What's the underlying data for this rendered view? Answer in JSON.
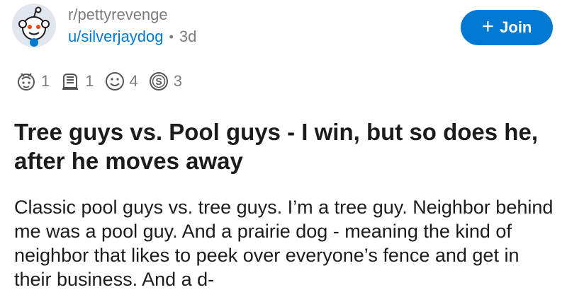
{
  "post": {
    "subreddit": "r/pettyrevenge",
    "author": "u/silverjaydog",
    "separator": "•",
    "age": "3d",
    "join_label": "Join",
    "join_icon": "plus-icon",
    "awards": [
      {
        "icon": "award-ribbon-icon",
        "count": "1"
      },
      {
        "icon": "award-hands-icon",
        "count": "1"
      },
      {
        "icon": "award-face-icon",
        "count": "4"
      },
      {
        "icon": "award-coin-icon",
        "count": "3"
      }
    ],
    "title": "Tree guys vs. Pool guys - I win, but so does he, after he moves away",
    "body": "Classic pool guys vs. tree guys. I’m a tree guy. Neighbor behind me was a pool guy. And a prairie dog - meaning the kind of neighbor that likes to peek over everyone’s fence and get in their business. And a d-"
  },
  "colors": {
    "accent": "#0079d3",
    "muted": "#7c7c7c",
    "text": "#1c1c1c"
  }
}
